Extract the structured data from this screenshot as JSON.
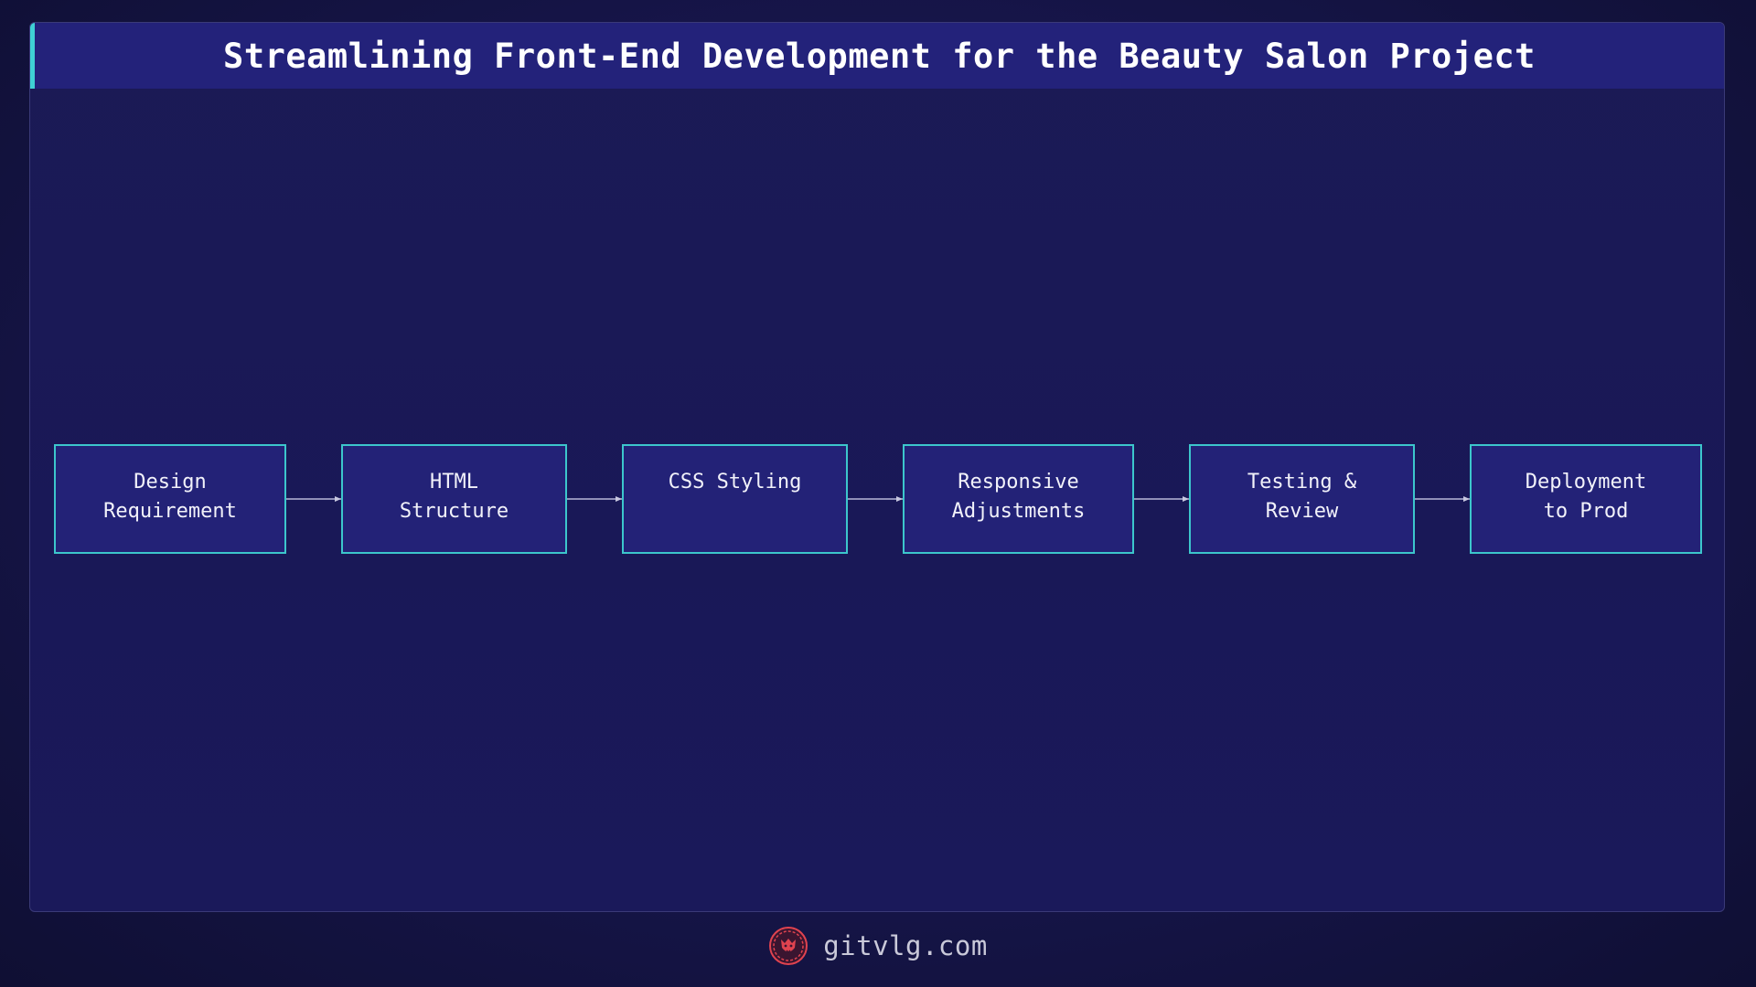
{
  "title": "Streamlining Front-End Development for the Beauty Salon Project",
  "flow": {
    "steps": [
      {
        "label": "Design\nRequirement"
      },
      {
        "label": "HTML\nStructure"
      },
      {
        "label": "CSS Styling"
      },
      {
        "label": "Responsive\nAdjustments"
      },
      {
        "label": "Testing &\nReview"
      },
      {
        "label": "Deployment\nto Prod"
      }
    ]
  },
  "footer": {
    "logo_icon": "lion-logo-icon",
    "site": "gitvlg.com"
  },
  "colors": {
    "accent": "#3fd0d4",
    "node_fill": "#232277",
    "node_border": "#3cc6cc",
    "logo": "#e0434f"
  }
}
